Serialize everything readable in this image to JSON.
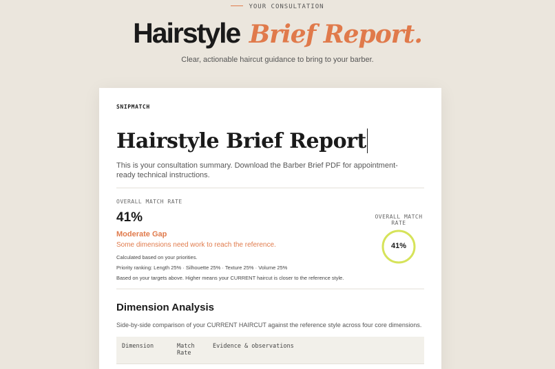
{
  "header": {
    "eyebrow": "YOUR CONSULTATION",
    "title_plain": "Hairstyle",
    "title_accent": "Brief Report.",
    "subtitle": "Clear, actionable haircut guidance to bring to your barber."
  },
  "card": {
    "brand": "SNIPMATCH",
    "title": "Hairstyle Brief Report",
    "intro": "This is your consultation summary. Download the Barber Brief PDF for appointment-ready technical instructions.",
    "match": {
      "label": "OVERALL MATCH RATE",
      "value": "41%",
      "percent": 41,
      "status": "Moderate Gap",
      "status_desc": "Some dimensions need work to reach the reference.",
      "calc_note": "Calculated based on your priorities.",
      "ranking": "Priority ranking: Length 25% · Silhouette 25% · Texture 25% · Volume 25%",
      "basis": "Based on your targets above. Higher means your CURRENT haircut is closer to the reference style."
    },
    "gauge": {
      "label": "OVERALL MATCH RATE",
      "value": "41%"
    },
    "analysis": {
      "title": "Dimension Analysis",
      "desc": "Side-by-side comparison of your CURRENT HAIRCUT against the reference style across four core dimensions.",
      "columns": [
        "Dimension",
        "Match Rate",
        "Evidence & observations"
      ]
    }
  },
  "colors": {
    "accent": "#e07a4b",
    "gauge_ring": "#d6e35a",
    "background": "#ebe6dd"
  }
}
